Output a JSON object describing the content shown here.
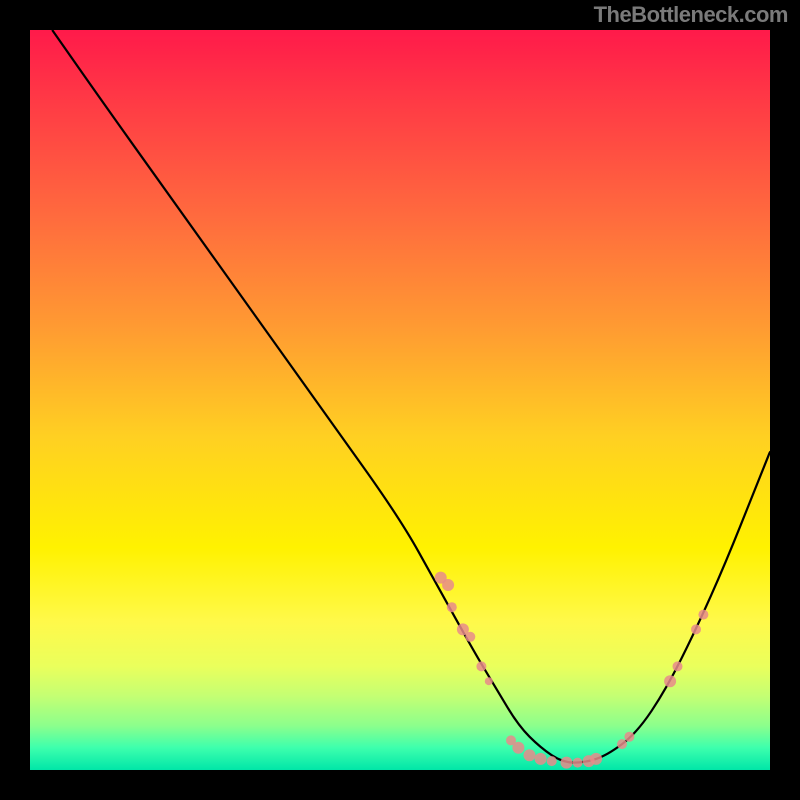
{
  "attribution": "TheBottleneck.com",
  "chart_data": {
    "type": "line",
    "title": "",
    "xlabel": "",
    "ylabel": "",
    "xlim": [
      0,
      100
    ],
    "ylim": [
      0,
      100
    ],
    "grid": false,
    "legend": false,
    "series": [
      {
        "name": "curve",
        "x": [
          3,
          10,
          20,
          30,
          40,
          50,
          55,
          60,
          63,
          66,
          69,
          72,
          75,
          78,
          82,
          86,
          90,
          94,
          98,
          100
        ],
        "y": [
          100,
          90,
          76,
          62,
          48,
          34,
          25,
          16,
          11,
          6,
          3,
          1,
          1,
          2,
          5,
          11,
          19,
          28,
          38,
          43
        ]
      }
    ],
    "markers": [
      {
        "x": 55.5,
        "y": 26.0,
        "r": 6
      },
      {
        "x": 56.5,
        "y": 25.0,
        "r": 6
      },
      {
        "x": 57.0,
        "y": 22.0,
        "r": 5
      },
      {
        "x": 58.5,
        "y": 19.0,
        "r": 6
      },
      {
        "x": 59.5,
        "y": 18.0,
        "r": 5
      },
      {
        "x": 61.0,
        "y": 14.0,
        "r": 5
      },
      {
        "x": 62.0,
        "y": 12.0,
        "r": 4
      },
      {
        "x": 65.0,
        "y": 4.0,
        "r": 5
      },
      {
        "x": 66.0,
        "y": 3.0,
        "r": 6
      },
      {
        "x": 67.5,
        "y": 2.0,
        "r": 6
      },
      {
        "x": 69.0,
        "y": 1.5,
        "r": 6
      },
      {
        "x": 70.5,
        "y": 1.2,
        "r": 5
      },
      {
        "x": 72.5,
        "y": 1.0,
        "r": 6
      },
      {
        "x": 74.0,
        "y": 1.0,
        "r": 5
      },
      {
        "x": 75.5,
        "y": 1.2,
        "r": 6
      },
      {
        "x": 76.5,
        "y": 1.5,
        "r": 6
      },
      {
        "x": 80.0,
        "y": 3.5,
        "r": 5
      },
      {
        "x": 81.0,
        "y": 4.5,
        "r": 5
      },
      {
        "x": 86.5,
        "y": 12.0,
        "r": 6
      },
      {
        "x": 87.5,
        "y": 14.0,
        "r": 5
      },
      {
        "x": 90.0,
        "y": 19.0,
        "r": 5
      },
      {
        "x": 91.0,
        "y": 21.0,
        "r": 5
      }
    ],
    "background_gradient": {
      "top": "#ff1a4a",
      "mid": "#fff200",
      "bottom": "#00e6a8"
    }
  }
}
